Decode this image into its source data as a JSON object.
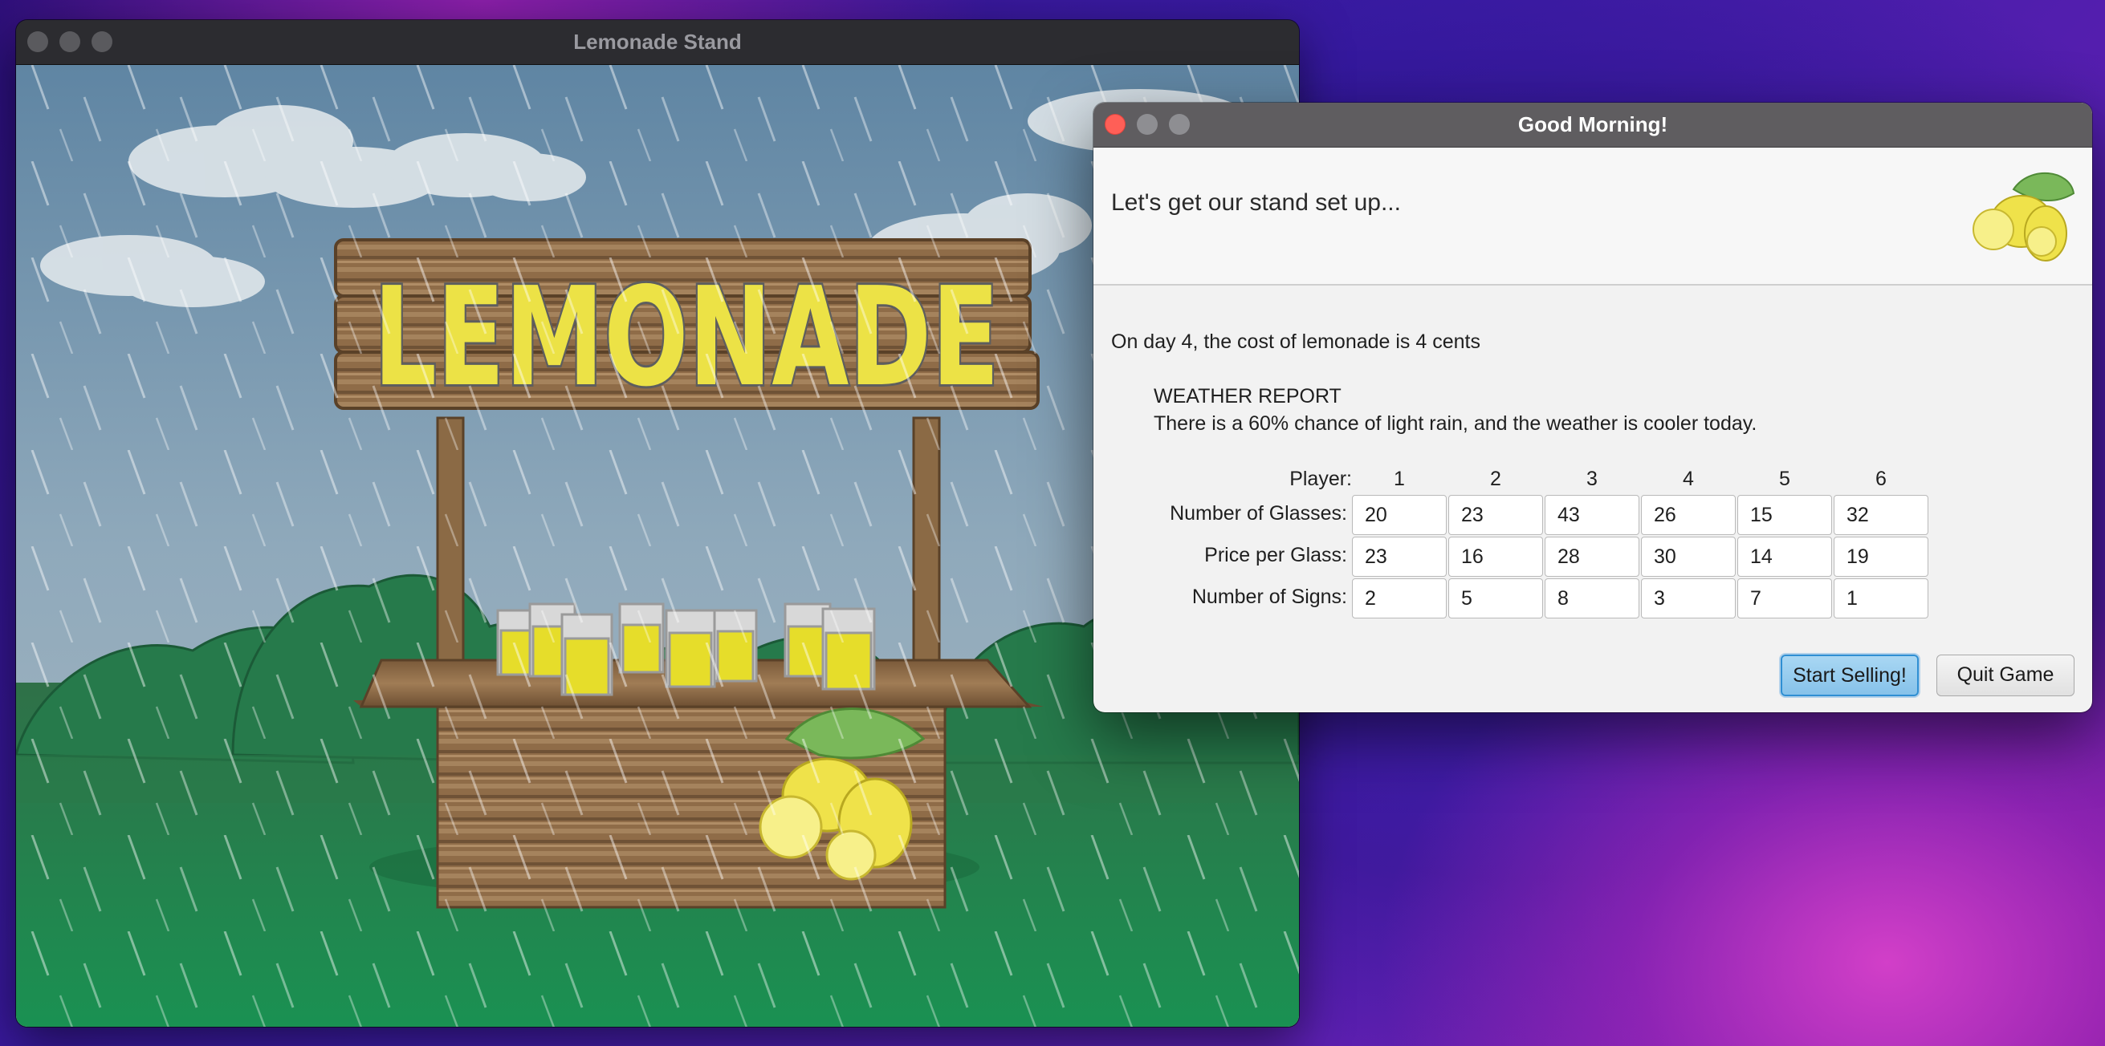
{
  "main_window": {
    "title": "Lemonade Stand",
    "sign_text": "LEMONADE"
  },
  "dialog": {
    "title": "Good Morning!",
    "header": "Let's get our stand set up...",
    "cost_line": "On day 4, the cost of lemonade is 4 cents",
    "weather_title": "WEATHER REPORT",
    "weather_text": "There is a 60% chance of light rain, and the weather is cooler today.",
    "player_label": "Player:",
    "players": [
      "1",
      "2",
      "3",
      "4",
      "5",
      "6"
    ],
    "rows": [
      {
        "label": "Number of Glasses:",
        "values": [
          "20",
          "23",
          "43",
          "26",
          "15",
          "32"
        ]
      },
      {
        "label": "Price per Glass:",
        "values": [
          "23",
          "16",
          "28",
          "30",
          "14",
          "19"
        ]
      },
      {
        "label": "Number of Signs:",
        "values": [
          "2",
          "5",
          "8",
          "3",
          "7",
          "1"
        ]
      }
    ],
    "start_button": "Start Selling!",
    "quit_button": "Quit Game"
  }
}
